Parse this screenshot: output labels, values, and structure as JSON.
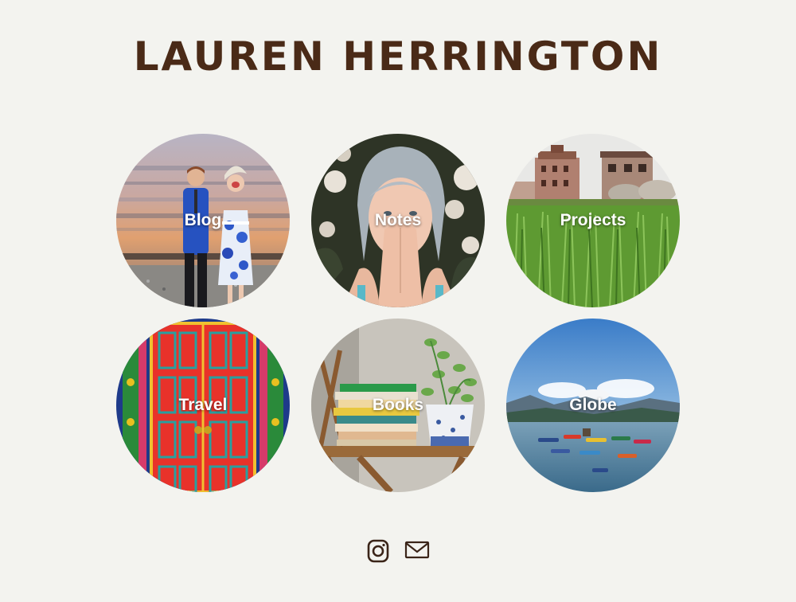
{
  "header": {
    "title": "Lauren Herrington"
  },
  "tiles": [
    {
      "label": "Blog",
      "image": "couple-by-train-photo"
    },
    {
      "label": "Notes",
      "image": "woman-portrait-flowers-photo"
    },
    {
      "label": "Projects",
      "image": "village-rice-field-photo"
    },
    {
      "label": "Travel",
      "image": "red-painted-door-photo"
    },
    {
      "label": "Books",
      "image": "book-stack-plant-photo"
    },
    {
      "label": "Globe",
      "image": "lake-boats-mountains-photo"
    }
  ],
  "footer": {
    "icons": [
      "instagram-icon",
      "mail-icon"
    ]
  },
  "colors": {
    "background": "#f3f3ef",
    "title": "#4a2a17",
    "icons": "#3a2418",
    "label": "#ffffff"
  }
}
